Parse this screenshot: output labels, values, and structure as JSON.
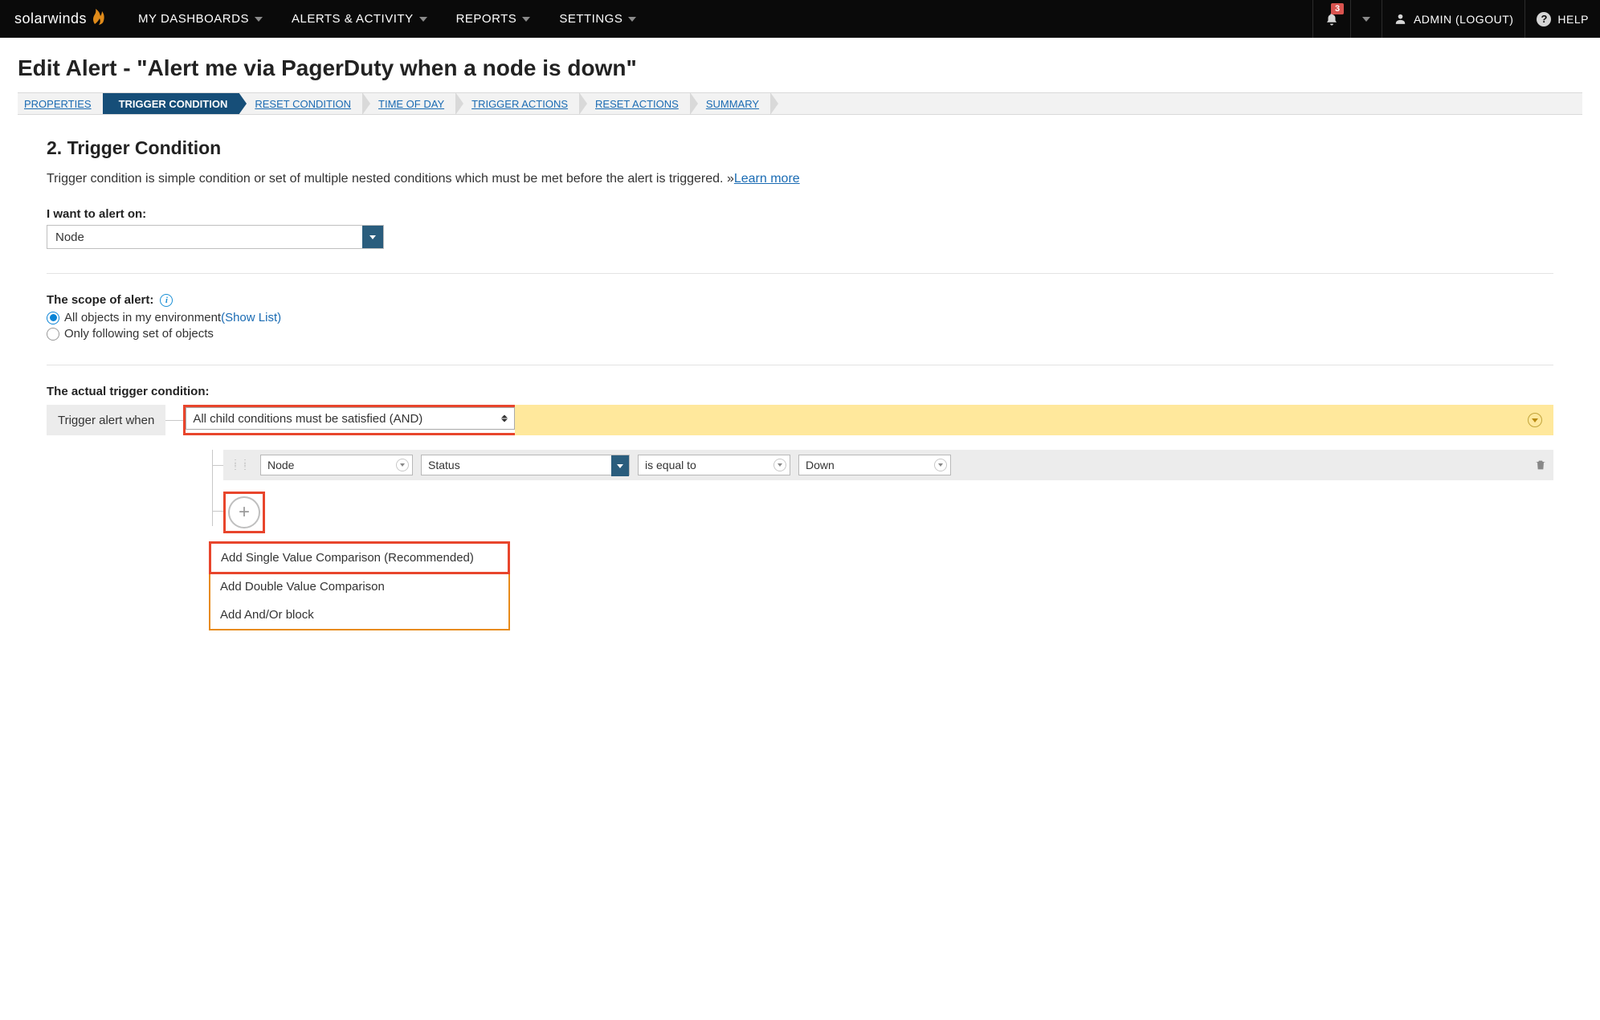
{
  "brand": "solarwinds",
  "nav": {
    "items": [
      "MY DASHBOARDS",
      "ALERTS & ACTIVITY",
      "REPORTS",
      "SETTINGS"
    ],
    "badge": "3",
    "user_label": "ADMIN",
    "logout_label": "(LOGOUT)",
    "help_label": "HELP"
  },
  "page_title": "Edit Alert - \"Alert me via PagerDuty when a node is down\"",
  "wizard": {
    "steps": [
      "PROPERTIES",
      "TRIGGER CONDITION",
      "RESET CONDITION",
      "TIME OF DAY",
      "TRIGGER ACTIONS",
      "RESET ACTIONS",
      "SUMMARY"
    ],
    "active_index": 1
  },
  "section": {
    "title": "2. Trigger Condition",
    "desc_prefix": "Trigger condition is simple condition or set of multiple nested conditions which must be met before the alert is triggered. »",
    "learn_more": "Learn more"
  },
  "alert_on": {
    "label": "I want to alert on:",
    "value": "Node"
  },
  "scope": {
    "label": "The scope of alert:",
    "opt_all": "All objects in my environment ",
    "show_list": "(Show List)",
    "opt_only": "Only following set of objects"
  },
  "trigger": {
    "label": "The actual trigger condition:",
    "lead": "Trigger alert when",
    "group_op": "All child conditions must be satisfied (AND)",
    "row": {
      "object": "Node",
      "property": "Status",
      "operator": "is equal to",
      "value": "Down"
    },
    "menu": {
      "add_single": "Add Single Value Comparison (Recommended)",
      "add_double": "Add Double Value Comparison",
      "add_block": "Add And/Or block"
    }
  }
}
